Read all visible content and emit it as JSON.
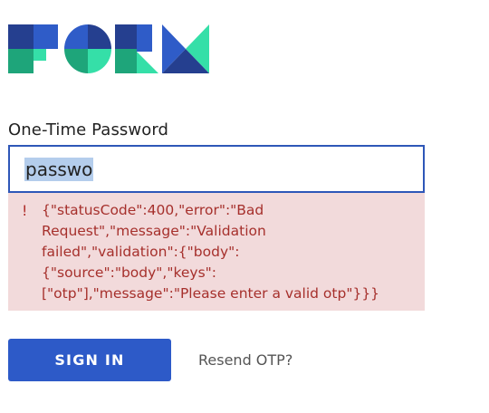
{
  "logo": {
    "name": "form-logo",
    "colors": {
      "navy": "#253f8f",
      "blue": "#2f5cc8",
      "green": "#1ea57a",
      "mint": "#35dfa8"
    }
  },
  "form": {
    "otp_label": "One-Time Password",
    "otp_value": "passwo",
    "error_icon": "!",
    "error_message": "{\"statusCode\":400,\"error\":\"Bad\nRequest\",\"message\":\"Validation\nfailed\",\"validation\":{\"body\":\n{\"source\":\"body\",\"keys\":\n[\"otp\"],\"message\":\"Please enter a valid otp\"}}}"
  },
  "actions": {
    "sign_in_label": "SIGN IN",
    "resend_label": "Resend OTP?"
  },
  "colors": {
    "accent": "#2d5ac8",
    "error_bg": "#f2dadb",
    "error_text": "#a6302c"
  }
}
